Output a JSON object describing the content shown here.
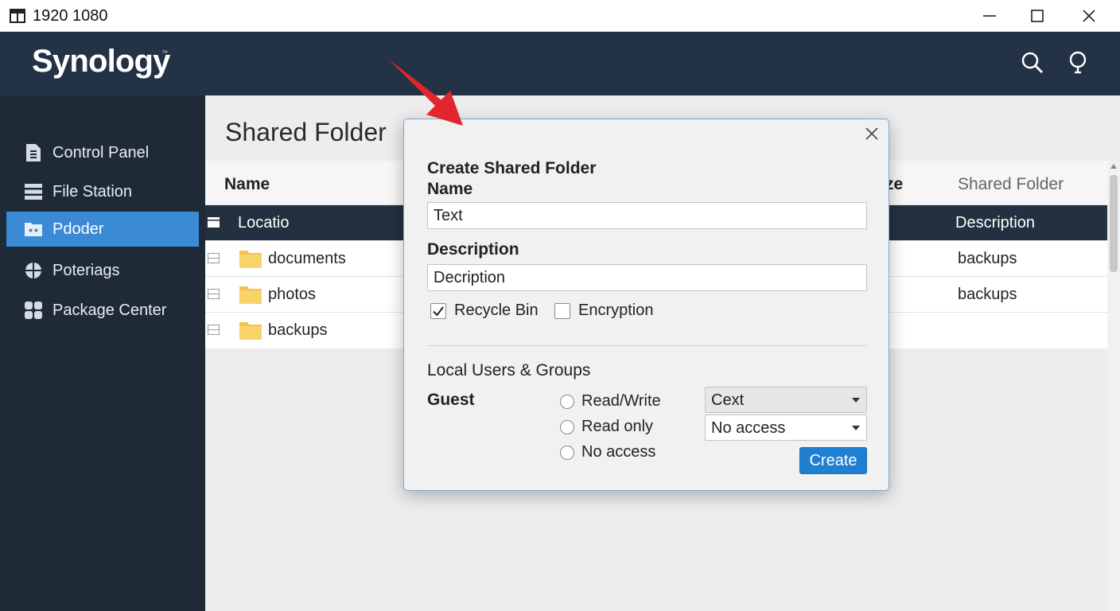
{
  "window": {
    "title": "1920 1080",
    "controls": [
      "minimize",
      "maximize",
      "close"
    ]
  },
  "header": {
    "logo": "Synology",
    "logo_mark": "™",
    "icons": [
      "search-icon",
      "bulb-icon"
    ]
  },
  "sidebar": {
    "items": [
      {
        "label": "Control Panel",
        "icon": "document-icon",
        "active": false
      },
      {
        "label": "File Station",
        "icon": "server-icon",
        "active": false
      },
      {
        "label": "Pdoder",
        "icon": "folder-share-icon",
        "active": true
      },
      {
        "label": "Poteriags",
        "icon": "grid-icon",
        "active": false
      },
      {
        "label": "Package Center",
        "icon": "package-icon",
        "active": false
      }
    ]
  },
  "main": {
    "title": "Shared Folder",
    "table": {
      "columns": {
        "name": "Name",
        "size": "ze",
        "shared_folder": "Shared Folder"
      },
      "selected_row": {
        "name": "Locatio",
        "shared_folder": "Description"
      },
      "rows": [
        {
          "name": "documents",
          "shared_folder": "backups"
        },
        {
          "name": "photos",
          "shared_folder": "backups"
        },
        {
          "name": "backups",
          "shared_folder": ""
        }
      ]
    }
  },
  "dialog": {
    "heading": "Create Shared Folder",
    "name_label": "Name",
    "name_value": "Text",
    "description_label": "Description",
    "description_value": "Decription",
    "recycle_bin_label": "Recycle Bin",
    "recycle_bin_checked": true,
    "encryption_label": "Encryption",
    "encryption_checked": false,
    "section_title": "Local Users & Groups",
    "guest_label": "Guest",
    "radios": [
      "Read/Write",
      "Read only",
      "No access"
    ],
    "select_1": "Cext",
    "select_2": "No access",
    "create_label": "Create"
  },
  "colors": {
    "header_bg": "#243245",
    "sidebar_bg": "#1f2a37",
    "active_nav": "#3a8ad6",
    "selected_row": "#23303f",
    "primary_button": "#1f7fd1",
    "annotation_arrow": "#e3262e"
  }
}
